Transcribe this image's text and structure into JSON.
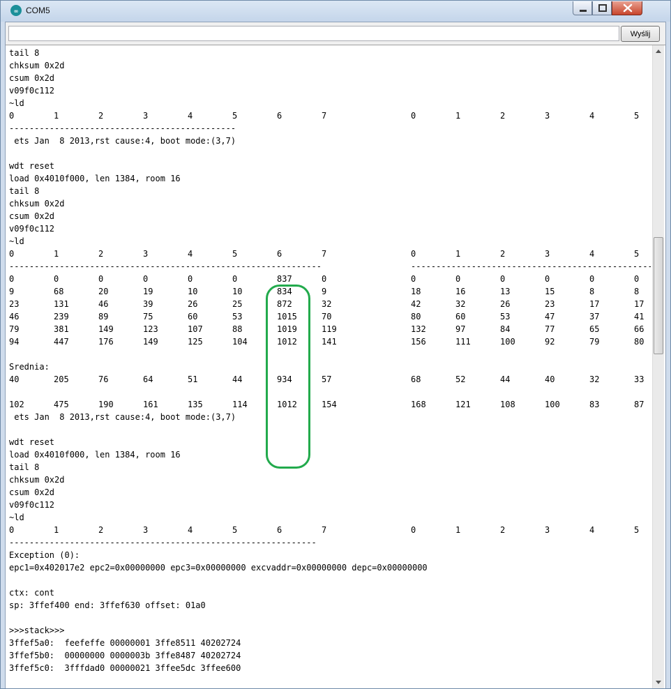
{
  "window": {
    "title": "COM5",
    "send_button": "Wyślij",
    "send_input_value": ""
  },
  "colors": {
    "highlight": "#22aa4c",
    "app_icon": "#1b8f99"
  },
  "console": [
    {
      "text": "tail 8"
    },
    {
      "text": "chksum 0x2d"
    },
    {
      "text": "csum 0x2d"
    },
    {
      "text": "v09f0c112"
    },
    {
      "text": "~ld"
    },
    {
      "cells": [
        "0",
        "1",
        "2",
        "3",
        "4",
        "5",
        "6",
        "7",
        "",
        "0",
        "1",
        "2",
        "3",
        "4",
        "5"
      ]
    },
    {
      "dash_short": "---------------------------------------------"
    },
    {
      "text": " ets Jan  8 2013,rst cause:4, boot mode:(3,7)"
    },
    {
      "text": ""
    },
    {
      "text": "wdt reset"
    },
    {
      "text": "load 0x4010f000, len 1384, room 16"
    },
    {
      "text": "tail 8"
    },
    {
      "text": "chksum 0x2d"
    },
    {
      "text": "csum 0x2d"
    },
    {
      "text": "v09f0c112"
    },
    {
      "text": "~ld"
    },
    {
      "cells": [
        "0",
        "1",
        "2",
        "3",
        "4",
        "5",
        "6",
        "7",
        "",
        "0",
        "1",
        "2",
        "3",
        "4",
        "5"
      ]
    },
    {
      "dash_left": "--------------------------------------------------------------",
      "dash_right": "-------------------------------------------------"
    },
    {
      "cells": [
        "0",
        "0",
        "0",
        "0",
        "0",
        "0",
        "837",
        "0",
        "",
        "0",
        "0",
        "0",
        "0",
        "0",
        "0"
      ]
    },
    {
      "cells": [
        "9",
        "68",
        "20",
        "19",
        "10",
        "10",
        "834",
        "9",
        "",
        "18",
        "16",
        "13",
        "15",
        "8",
        "8"
      ]
    },
    {
      "cells": [
        "23",
        "131",
        "46",
        "39",
        "26",
        "25",
        "872",
        "32",
        "",
        "42",
        "32",
        "26",
        "23",
        "17",
        "17"
      ]
    },
    {
      "cells": [
        "46",
        "239",
        "89",
        "75",
        "60",
        "53",
        "1015",
        "70",
        "",
        "80",
        "60",
        "53",
        "47",
        "37",
        "41"
      ]
    },
    {
      "cells": [
        "79",
        "381",
        "149",
        "123",
        "107",
        "88",
        "1019",
        "119",
        "",
        "132",
        "97",
        "84",
        "77",
        "65",
        "66"
      ]
    },
    {
      "cells": [
        "94",
        "447",
        "176",
        "149",
        "125",
        "104",
        "1012",
        "141",
        "",
        "156",
        "111",
        "100",
        "92",
        "79",
        "80"
      ]
    },
    {
      "text": ""
    },
    {
      "text": "Srednia:"
    },
    {
      "cells": [
        "40",
        "205",
        "76",
        "64",
        "51",
        "44",
        "934",
        "57",
        "",
        "68",
        "52",
        "44",
        "40",
        "32",
        "33"
      ]
    },
    {
      "text": ""
    },
    {
      "cells": [
        "102",
        "475",
        "190",
        "161",
        "135",
        "114",
        "1012",
        "154",
        "",
        "168",
        "121",
        "108",
        "100",
        "83",
        "87"
      ]
    },
    {
      "text": " ets Jan  8 2013,rst cause:4, boot mode:(3,7)"
    },
    {
      "text": ""
    },
    {
      "text": "wdt reset"
    },
    {
      "text": "load 0x4010f000, len 1384, room 16"
    },
    {
      "text": "tail 8"
    },
    {
      "text": "chksum 0x2d"
    },
    {
      "text": "csum 0x2d"
    },
    {
      "text": "v09f0c112"
    },
    {
      "text": "~ld"
    },
    {
      "cells": [
        "0",
        "1",
        "2",
        "3",
        "4",
        "5",
        "6",
        "7",
        "",
        "0",
        "1",
        "2",
        "3",
        "4",
        "5"
      ]
    },
    {
      "dash_short": "-------------------------------------------------------------"
    },
    {
      "text": "Exception (0):"
    },
    {
      "text": "epc1=0x402017e2 epc2=0x00000000 epc3=0x00000000 excvaddr=0x00000000 depc=0x00000000"
    },
    {
      "text": ""
    },
    {
      "text": "ctx: cont"
    },
    {
      "text": "sp: 3ffef400 end: 3ffef630 offset: 01a0"
    },
    {
      "text": ""
    },
    {
      "text": ">>>stack>>>"
    },
    {
      "text": "3ffef5a0:  feefeffe 00000001 3ffe8511 40202724"
    },
    {
      "text": "3ffef5b0:  00000000 0000003b 3ffe8487 40202724"
    },
    {
      "text": "3ffef5c0:  3fffdad0 00000021 3ffee5dc 3ffee600"
    }
  ]
}
